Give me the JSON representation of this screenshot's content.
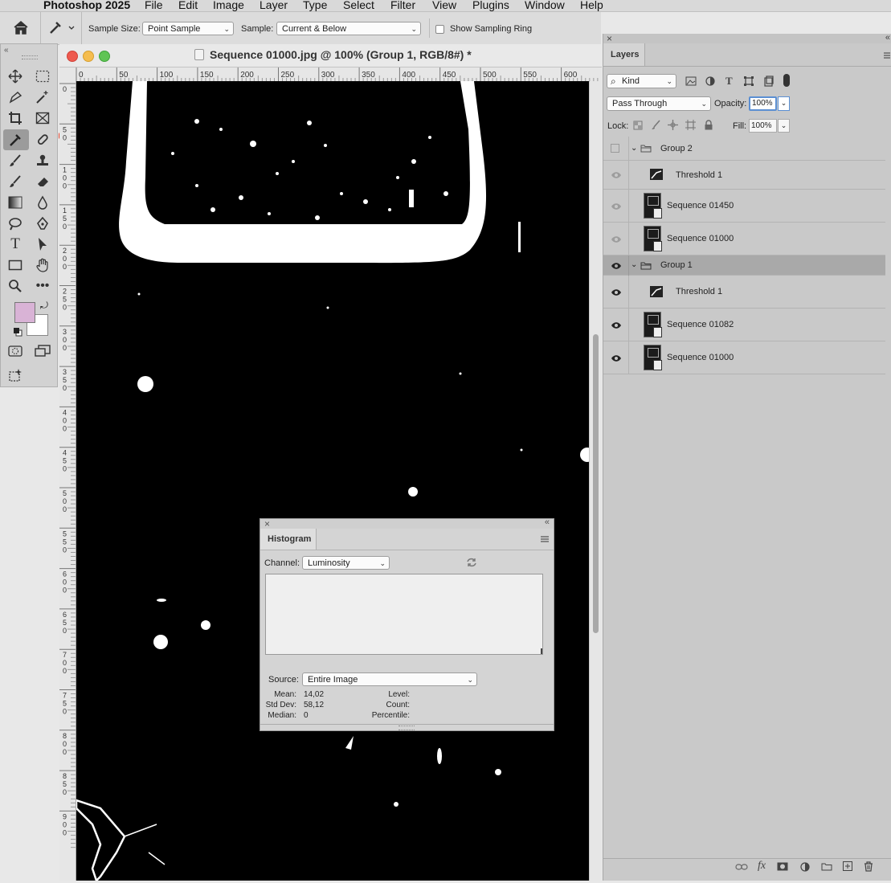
{
  "menubar": {
    "app": "Photoshop 2025",
    "items": [
      "File",
      "Edit",
      "Image",
      "Layer",
      "Type",
      "Select",
      "Filter",
      "View",
      "Plugins",
      "Window",
      "Help"
    ]
  },
  "options": {
    "sample_size_label": "Sample Size:",
    "sample_size_value": "Point Sample",
    "sample_label": "Sample:",
    "sample_value": "Current & Below",
    "show_ring_label": "Show Sampling Ring"
  },
  "document": {
    "title": "Sequence 01000.jpg @ 100% (Group 1, RGB/8#) *",
    "ruler_top": [
      "0",
      "50",
      "100",
      "150",
      "200",
      "250",
      "300",
      "350",
      "400",
      "450",
      "500",
      "550",
      "600"
    ],
    "ruler_left": [
      "0",
      "5\n0",
      "1\n0\n0",
      "1\n5\n0",
      "2\n0\n0",
      "2\n5\n0",
      "3\n0\n0",
      "3\n5\n0",
      "4\n0\n0",
      "4\n5\n0",
      "5\n0\n0",
      "5\n5\n0",
      "6\n0\n0",
      "6\n5\n0",
      "7\n0\n0",
      "7\n5\n0",
      "8\n0\n0",
      "8\n5\n0",
      "9\n0\n0"
    ]
  },
  "histogram": {
    "title": "Histogram",
    "channel_label": "Channel:",
    "channel_value": "Luminosity",
    "source_label": "Source:",
    "source_value": "Entire Image",
    "mean_label": "Mean:",
    "mean_value": "14,02",
    "stddev_label": "Std Dev:",
    "stddev_value": "58,12",
    "median_label": "Median:",
    "median_value": "0",
    "level_label": "Level:",
    "count_label": "Count:",
    "percentile_label": "Percentile:"
  },
  "layers": {
    "tab": "Layers",
    "filter_kind": "Kind",
    "blend_mode": "Pass Through",
    "opacity_label": "Opacity:",
    "opacity_value": "100%",
    "lock_label": "Lock:",
    "fill_label": "Fill:",
    "fill_value": "100%",
    "rows": [
      {
        "name": "Group 2",
        "type": "group",
        "visible": false,
        "selected": false
      },
      {
        "name": "Threshold 1",
        "type": "adjustment",
        "visible": false,
        "selected": false
      },
      {
        "name": "Sequence 01450",
        "type": "smart",
        "visible": false,
        "selected": false
      },
      {
        "name": "Sequence 01000",
        "type": "smart",
        "visible": false,
        "selected": false
      },
      {
        "name": "Group 1",
        "type": "group",
        "visible": true,
        "selected": true
      },
      {
        "name": "Threshold 1",
        "type": "adjustment",
        "visible": true,
        "selected": false
      },
      {
        "name": "Sequence 01082",
        "type": "smart",
        "visible": true,
        "selected": false
      },
      {
        "name": "Sequence 01000",
        "type": "smart",
        "visible": true,
        "selected": false
      }
    ]
  },
  "colors": {
    "foreground": "#d9b3d6",
    "background": "#ffffff",
    "selected_row": "#a9a9a9"
  }
}
